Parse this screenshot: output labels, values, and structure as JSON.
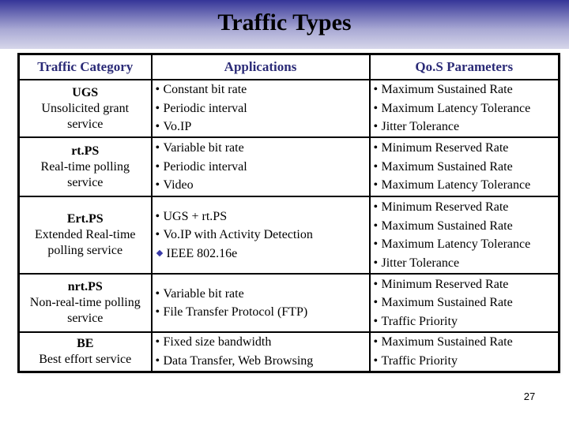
{
  "slide": {
    "title": "Traffic Types",
    "page_number": "27",
    "accent_color": "#2b2b77",
    "band_top_color": "#353598"
  },
  "table": {
    "headers": [
      "Traffic Category",
      "Applications",
      "Qo.S Parameters"
    ],
    "rows": [
      {
        "code": "UGS",
        "name": "Unsolicited grant service",
        "applications": [
          {
            "bullet": "dot",
            "text": "Constant bit rate"
          },
          {
            "bullet": "dot",
            "text": "Periodic interval"
          },
          {
            "bullet": "dot",
            "text": "Vo.IP"
          }
        ],
        "qos": [
          "Maximum Sustained Rate",
          "Maximum Latency Tolerance",
          "Jitter Tolerance"
        ]
      },
      {
        "code": "rt.PS",
        "name": "Real-time polling service",
        "applications": [
          {
            "bullet": "dot",
            "text": "Variable bit rate"
          },
          {
            "bullet": "dot",
            "text": "Periodic interval"
          },
          {
            "bullet": "dot",
            "text": "Video"
          }
        ],
        "qos": [
          "Minimum Reserved Rate",
          "Maximum Sustained Rate",
          "Maximum Latency Tolerance"
        ]
      },
      {
        "code": "Ert.PS",
        "name": "Extended Real-time polling service",
        "applications": [
          {
            "bullet": "dot",
            "text": "UGS + rt.PS"
          },
          {
            "bullet": "dot",
            "text": "Vo.IP with Activity Detection"
          },
          {
            "bullet": "diamond",
            "text": "IEEE 802.16e"
          }
        ],
        "qos": [
          "Minimum Reserved Rate",
          "Maximum Sustained Rate",
          "Maximum Latency Tolerance",
          "Jitter Tolerance"
        ]
      },
      {
        "code": "nrt.PS",
        "name": "Non-real-time polling service",
        "applications": [
          {
            "bullet": "dot",
            "text": "Variable bit rate"
          },
          {
            "bullet": "dot",
            "text": "File Transfer Protocol (FTP)"
          }
        ],
        "qos": [
          "Minimum Reserved Rate",
          "Maximum Sustained Rate",
          "Traffic Priority"
        ]
      },
      {
        "code": "BE",
        "name": "Best effort service",
        "applications": [
          {
            "bullet": "dot",
            "text": "Fixed size bandwidth"
          },
          {
            "bullet": "dot",
            "text": "Data Transfer, Web Browsing"
          }
        ],
        "qos": [
          "Maximum Sustained Rate",
          "Traffic Priority"
        ]
      }
    ]
  }
}
